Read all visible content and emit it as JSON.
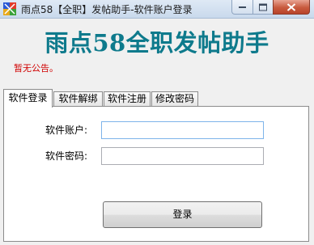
{
  "window": {
    "title": "雨点58【全职】发帖助手-软件账户登录"
  },
  "header": {
    "heading": "雨点58全职发帖助手",
    "notice": "暂无公告。"
  },
  "tabs": [
    {
      "label": "软件登录",
      "active": true
    },
    {
      "label": "软件解绑",
      "active": false
    },
    {
      "label": "软件注册",
      "active": false
    },
    {
      "label": "修改密码",
      "active": false
    }
  ],
  "form": {
    "account_label": "软件账户:",
    "account_value": "",
    "password_label": "软件密码:",
    "password_value": "",
    "login_label": "登录"
  },
  "colors": {
    "heading": "#0e7a8c",
    "notice": "#d00000"
  }
}
